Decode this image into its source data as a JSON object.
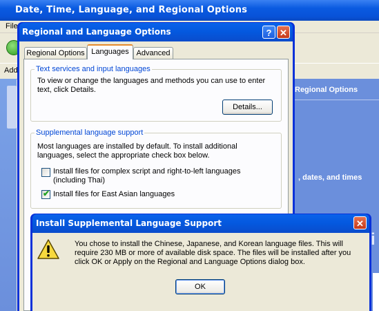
{
  "background_window": {
    "title": "Date, Time, Language, and Regional Options",
    "menu_text": "File",
    "address_text": "Add",
    "right_pane_heading": "Regional Options",
    "right_pane_text": ", dates, and times",
    "right_pane_big": "i"
  },
  "regional_dialog": {
    "title": "Regional and Language Options",
    "help_label": "?",
    "close_label": "✕",
    "tabs": [
      {
        "label": "Regional Options"
      },
      {
        "label": "Languages"
      },
      {
        "label": "Advanced"
      }
    ],
    "text_services": {
      "legend": "Text services and input languages",
      "description": "To view or change the languages and methods you can use to enter text, click Details.",
      "details_button": "Details..."
    },
    "supplemental": {
      "legend": "Supplemental language support",
      "description": "Most languages are installed by default. To install additional languages, select the appropriate check box below.",
      "complex_script_label": "Install files for complex script and right-to-left languages (including Thai)",
      "complex_script_checked": false,
      "east_asian_label": "Install files for East Asian languages",
      "east_asian_checked": true
    }
  },
  "install_dialog": {
    "title": "Install Supplemental Language Support",
    "close_label": "✕",
    "message": "You chose to install the Chinese, Japanese, and Korean language files. This will require 230 MB or more of available disk space. The files will be installed after you click OK or Apply on the Regional and Language Options dialog box.",
    "ok_button": "OK",
    "icon": "warning-icon"
  },
  "colors": {
    "titlebar_blue": "#0458de",
    "dialog_face": "#ece9d8",
    "group_legend": "#0046d5",
    "close_red": "#c4391b"
  }
}
